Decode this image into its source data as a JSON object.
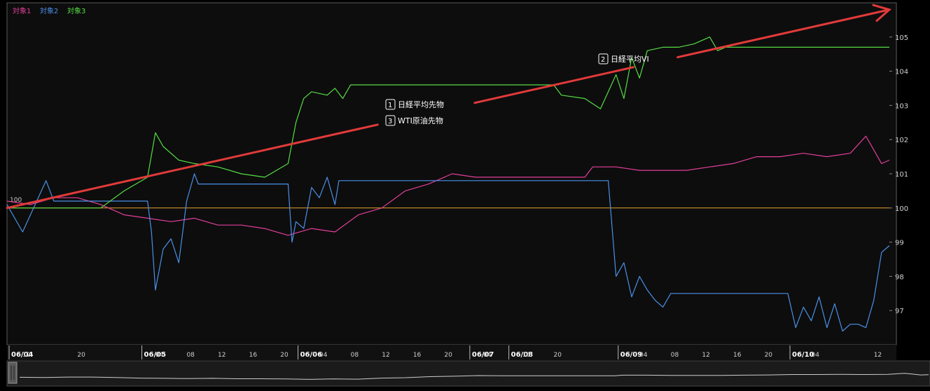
{
  "chart_data": {
    "type": "line",
    "legend": [
      {
        "label": "対象1",
        "color": "#e23f9a"
      },
      {
        "label": "対象2",
        "color": "#4a90e8"
      },
      {
        "label": "対象3",
        "color": "#55dd44"
      }
    ],
    "series": [
      {
        "name": "対象1",
        "label_badge": "1",
        "annotation": "日経平均先物",
        "color": "#e23f9a",
        "points": [
          [
            0,
            100.2
          ],
          [
            3,
            100.1
          ],
          [
            6,
            100.3
          ],
          [
            9,
            100.3
          ],
          [
            12,
            100.1
          ],
          [
            15,
            99.8
          ],
          [
            18,
            99.7
          ],
          [
            21,
            99.6
          ],
          [
            24,
            99.7
          ],
          [
            27,
            99.5
          ],
          [
            30,
            99.5
          ],
          [
            33,
            99.4
          ],
          [
            36,
            99.2
          ],
          [
            39,
            99.4
          ],
          [
            42,
            99.3
          ],
          [
            45,
            99.8
          ],
          [
            48,
            100.0
          ],
          [
            51,
            100.5
          ],
          [
            54,
            100.7
          ],
          [
            57,
            101.0
          ],
          [
            60,
            100.9
          ],
          [
            62,
            100.9
          ],
          [
            66,
            100.9
          ],
          [
            70,
            100.9
          ],
          [
            73,
            100.9
          ],
          [
            74,
            100.9
          ],
          [
            75,
            101.2
          ],
          [
            78,
            101.2
          ],
          [
            81,
            101.1
          ],
          [
            84,
            101.1
          ],
          [
            87,
            101.1
          ],
          [
            90,
            101.2
          ],
          [
            93,
            101.3
          ],
          [
            96,
            101.5
          ],
          [
            99,
            101.5
          ],
          [
            102,
            101.6
          ],
          [
            105,
            101.5
          ],
          [
            108,
            101.6
          ],
          [
            110,
            102.1
          ],
          [
            111,
            101.7
          ],
          [
            112,
            101.3
          ],
          [
            113,
            101.4
          ]
        ]
      },
      {
        "name": "対象2",
        "label_badge": "3",
        "annotation": "WTI原油先物",
        "color": "#4a90e8",
        "points": [
          [
            0,
            100.1
          ],
          [
            2,
            99.3
          ],
          [
            4,
            100.3
          ],
          [
            5,
            100.8
          ],
          [
            6,
            100.2
          ],
          [
            9,
            100.2
          ],
          [
            12,
            100.2
          ],
          [
            18,
            100.2
          ],
          [
            18.5,
            99.3
          ],
          [
            19,
            97.6
          ],
          [
            20,
            98.8
          ],
          [
            21,
            99.1
          ],
          [
            22,
            98.4
          ],
          [
            23,
            100.2
          ],
          [
            24,
            101.0
          ],
          [
            24.5,
            100.7
          ],
          [
            30,
            100.7
          ],
          [
            36,
            100.7
          ],
          [
            36.5,
            99.0
          ],
          [
            37,
            99.6
          ],
          [
            38,
            99.4
          ],
          [
            39,
            100.6
          ],
          [
            40,
            100.3
          ],
          [
            41,
            100.9
          ],
          [
            42,
            100.1
          ],
          [
            42.5,
            100.8
          ],
          [
            50,
            100.8
          ],
          [
            56,
            100.8
          ],
          [
            58,
            100.8
          ],
          [
            62,
            100.8
          ],
          [
            66,
            100.8
          ],
          [
            72,
            100.8
          ],
          [
            77,
            100.8
          ],
          [
            78,
            98.0
          ],
          [
            79,
            98.4
          ],
          [
            80,
            97.4
          ],
          [
            81,
            98.0
          ],
          [
            82,
            97.6
          ],
          [
            83,
            97.3
          ],
          [
            84,
            97.1
          ],
          [
            85,
            97.5
          ],
          [
            90,
            97.5
          ],
          [
            95,
            97.5
          ],
          [
            100,
            97.5
          ],
          [
            101,
            96.5
          ],
          [
            102,
            97.1
          ],
          [
            103,
            96.7
          ],
          [
            104,
            97.4
          ],
          [
            105,
            96.5
          ],
          [
            106,
            97.2
          ],
          [
            107,
            96.4
          ],
          [
            108,
            96.6
          ],
          [
            109,
            96.6
          ],
          [
            110,
            96.5
          ],
          [
            111,
            97.3
          ],
          [
            112,
            98.7
          ],
          [
            113,
            98.9
          ]
        ]
      },
      {
        "name": "対象3",
        "label_badge": "2",
        "annotation": "日経平均VI",
        "color": "#55dd44",
        "points": [
          [
            0,
            100.0
          ],
          [
            6,
            100.0
          ],
          [
            12,
            100.0
          ],
          [
            15,
            100.5
          ],
          [
            18,
            100.9
          ],
          [
            19,
            102.2
          ],
          [
            20,
            101.8
          ],
          [
            22,
            101.4
          ],
          [
            24,
            101.3
          ],
          [
            27,
            101.2
          ],
          [
            30,
            101.0
          ],
          [
            33,
            100.9
          ],
          [
            36,
            101.3
          ],
          [
            37,
            102.5
          ],
          [
            38,
            103.2
          ],
          [
            39,
            103.4
          ],
          [
            41,
            103.3
          ],
          [
            42,
            103.5
          ],
          [
            43,
            103.2
          ],
          [
            44,
            103.6
          ],
          [
            48,
            103.6
          ],
          [
            54,
            103.6
          ],
          [
            60,
            103.6
          ],
          [
            66,
            103.6
          ],
          [
            70,
            103.6
          ],
          [
            71,
            103.3
          ],
          [
            74,
            103.2
          ],
          [
            76,
            102.9
          ],
          [
            77,
            103.4
          ],
          [
            78,
            103.9
          ],
          [
            79,
            103.2
          ],
          [
            80,
            104.4
          ],
          [
            81,
            103.8
          ],
          [
            82,
            104.6
          ],
          [
            84,
            104.7
          ],
          [
            86,
            104.7
          ],
          [
            88,
            104.8
          ],
          [
            90,
            105.0
          ],
          [
            91,
            104.6
          ],
          [
            92,
            104.7
          ],
          [
            96,
            104.7
          ],
          [
            100,
            104.7
          ],
          [
            104,
            104.7
          ],
          [
            110,
            104.7
          ],
          [
            113,
            104.7
          ]
        ]
      }
    ],
    "reference_line": {
      "value": 100,
      "color": "#e8a22b",
      "label": "100"
    },
    "ylim": [
      96,
      106
    ],
    "yticks": [
      "97",
      "98",
      "99",
      "100",
      "101",
      "102",
      "103",
      "104",
      "105"
    ],
    "xaxis": {
      "date_labels": [
        {
          "at": 0,
          "label": "06/04"
        },
        {
          "at": 17,
          "label": "06/05"
        },
        {
          "at": 37,
          "label": "06/06"
        },
        {
          "at": 59,
          "label": "06/07"
        },
        {
          "at": 64,
          "label": "06/08"
        },
        {
          "at": 78,
          "label": "06/09"
        },
        {
          "at": 100,
          "label": "06/10"
        }
      ],
      "hour_labels": [
        {
          "at": 2,
          "label": "12"
        },
        {
          "at": 9,
          "label": "20"
        },
        {
          "at": 19,
          "label": "04"
        },
        {
          "at": 23,
          "label": "08"
        },
        {
          "at": 27,
          "label": "12"
        },
        {
          "at": 31,
          "label": "16"
        },
        {
          "at": 35,
          "label": "20"
        },
        {
          "at": 40,
          "label": "04"
        },
        {
          "at": 44,
          "label": "08"
        },
        {
          "at": 48,
          "label": "12"
        },
        {
          "at": 52,
          "label": "16"
        },
        {
          "at": 56,
          "label": "20"
        },
        {
          "at": 61,
          "label": "04"
        },
        {
          "at": 66,
          "label": "16"
        },
        {
          "at": 70,
          "label": "20"
        },
        {
          "at": 81,
          "label": "04"
        },
        {
          "at": 85,
          "label": "08"
        },
        {
          "at": 89,
          "label": "12"
        },
        {
          "at": 93,
          "label": "16"
        },
        {
          "at": 97,
          "label": "20"
        },
        {
          "at": 103,
          "label": "04"
        },
        {
          "at": 111,
          "label": "12"
        }
      ],
      "range": [
        0,
        113
      ]
    },
    "trend_arrow": {
      "color": "#e23a3a",
      "from": [
        0,
        100.0
      ],
      "to": [
        113,
        105.8
      ]
    }
  }
}
